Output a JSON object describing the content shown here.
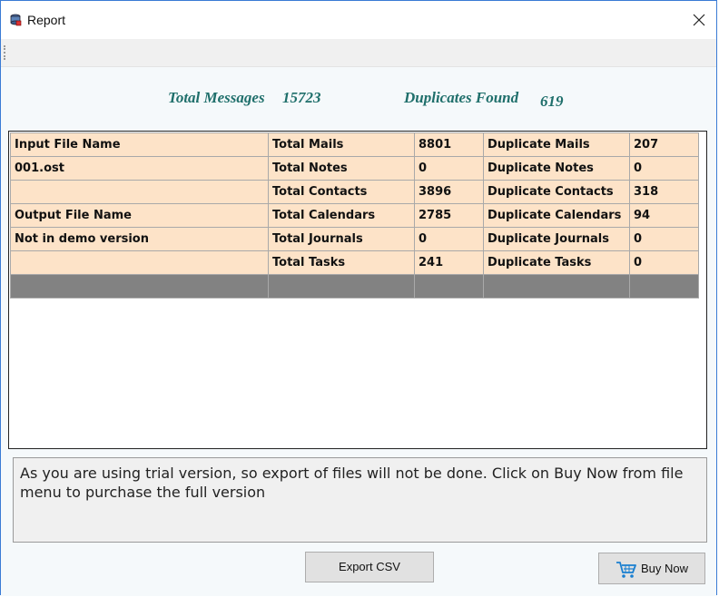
{
  "window": {
    "title": "Report",
    "close_label": "X"
  },
  "summary": {
    "total_messages_label": "Total Messages",
    "total_messages_value": "15723",
    "duplicates_label": "Duplicates Found",
    "duplicates_value": "619"
  },
  "table": {
    "rows": [
      [
        "Input File Name",
        "Total Mails",
        "8801",
        "Duplicate Mails",
        "207"
      ],
      [
        "001.ost",
        "Total Notes",
        "0",
        "Duplicate Notes",
        "0"
      ],
      [
        "",
        "Total Contacts",
        "3896",
        "Duplicate Contacts",
        "318"
      ],
      [
        "Output File Name",
        "Total Calendars",
        "2785",
        "Duplicate Calendars",
        "94"
      ],
      [
        "Not in demo version",
        "Total Journals",
        "0",
        "Duplicate Journals",
        "0"
      ],
      [
        "",
        "Total Tasks",
        "241",
        "Duplicate Tasks",
        "0"
      ]
    ]
  },
  "message": "As you are using trial version, so export of files will not be done. Click on Buy Now from file menu to purchase the full version",
  "buttons": {
    "export_label": "Export CSV",
    "buy_label": "Buy Now"
  },
  "icons": {
    "app": "report-app-icon",
    "cart": "shopping-cart-icon",
    "close": "close-icon"
  },
  "colors": {
    "row_bg": "#fde3c8",
    "summary_text": "#1f6f6b",
    "gray_row": "#828282"
  }
}
